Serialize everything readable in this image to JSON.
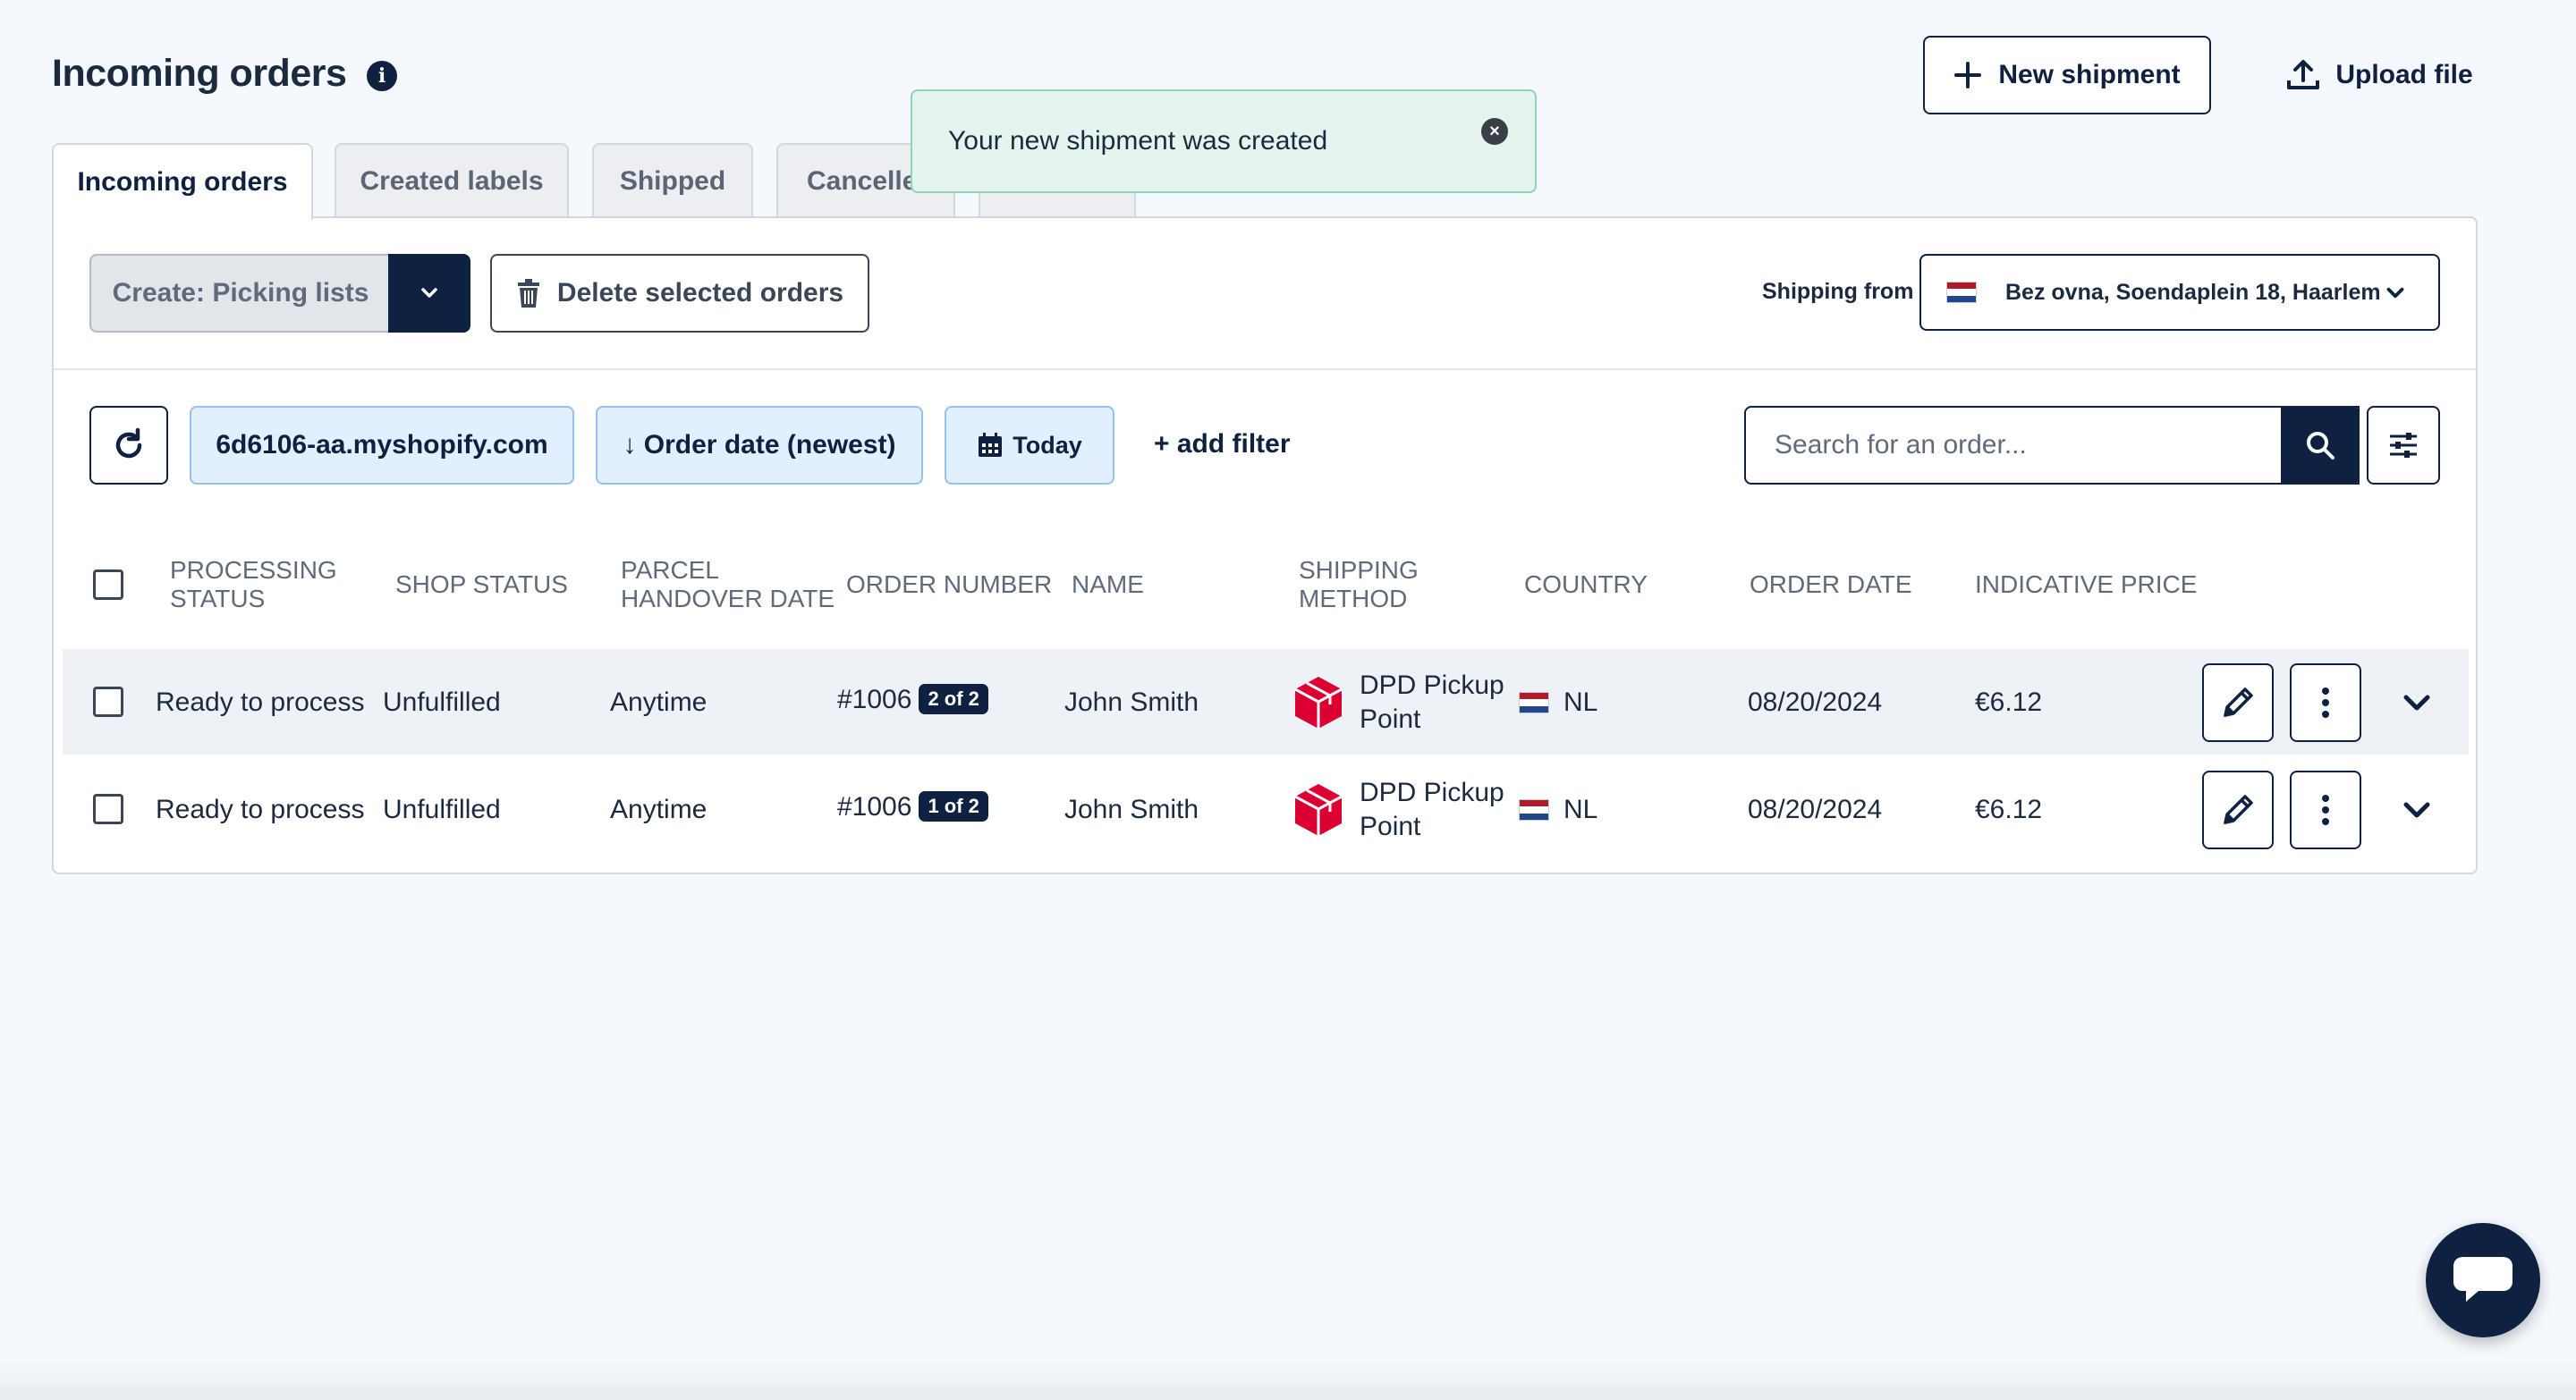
{
  "header": {
    "title": "Incoming orders",
    "new_shipment": "New shipment",
    "upload_file": "Upload file"
  },
  "tabs": [
    {
      "label": "Incoming orders",
      "active": true
    },
    {
      "label": "Created labels",
      "active": false
    },
    {
      "label": "Shipped",
      "active": false
    },
    {
      "label": "Cancelle",
      "active": false
    }
  ],
  "toast": {
    "message": "Your new shipment was created"
  },
  "toolbar": {
    "picking_lists": "Create: Picking lists",
    "delete_selected": "Delete selected orders",
    "shipping_from_label": "Shipping from",
    "shipping_from_value": "Bez ovna, Soendaplein 18, Haarlem"
  },
  "filters": {
    "shop": "6d6106-aa.myshopify.com",
    "sort": "↓ Order date (newest)",
    "date": "Today",
    "add_filter": "+ add filter",
    "search_placeholder": "Search for an order..."
  },
  "table": {
    "columns": {
      "processing_status": "PROCESSING STATUS",
      "shop_status": "SHOP STATUS",
      "parcel_handover_date": "PARCEL HANDOVER DATE",
      "order_number": "ORDER NUMBER",
      "name": "NAME",
      "shipping_method": "SHIPPING METHOD",
      "country": "COUNTRY",
      "order_date": "ORDER DATE",
      "indicative_price": "INDICATIVE PRICE"
    },
    "rows": [
      {
        "processing_status": "Ready to process",
        "shop_status": "Unfulfilled",
        "handover": "Anytime",
        "order_number": "#1006",
        "part": "2 of 2",
        "name": "John Smith",
        "method_line1": "DPD Pickup",
        "method_line2": "Point",
        "country": "NL",
        "order_date": "08/20/2024",
        "price": "€6.12"
      },
      {
        "processing_status": "Ready to process",
        "shop_status": "Unfulfilled",
        "handover": "Anytime",
        "order_number": "#1006",
        "part": "1 of 2",
        "name": "John Smith",
        "method_line1": "DPD Pickup",
        "method_line2": "Point",
        "country": "NL",
        "order_date": "08/20/2024",
        "price": "€6.12"
      }
    ]
  },
  "colors": {
    "navy": "#0f2140",
    "chip_bg": "#e1efff",
    "toast_bg": "#e6f4ef",
    "dpd_red": "#dc0032"
  }
}
